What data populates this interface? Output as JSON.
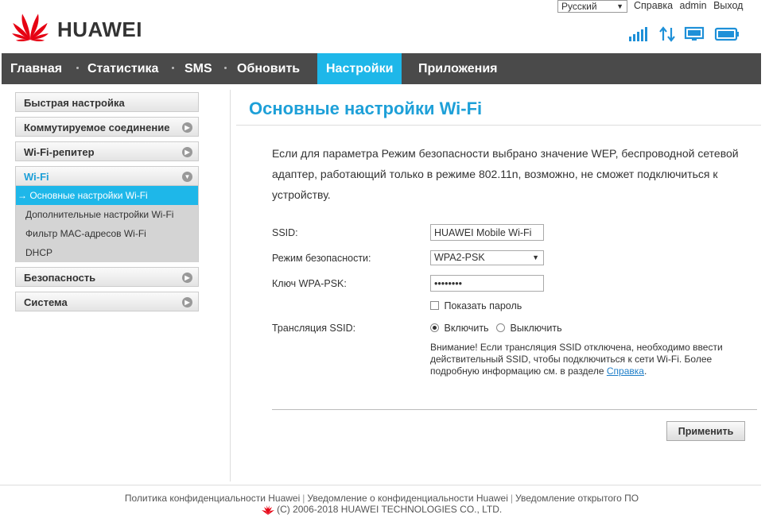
{
  "brand": {
    "name": "HUAWEI"
  },
  "top": {
    "language": "Русский",
    "links": [
      "Справка",
      "admin",
      "Выход"
    ]
  },
  "nav": {
    "items": [
      "Главная",
      "Статистика",
      "SMS",
      "Обновить",
      "Настройки",
      "Приложения"
    ],
    "active": "Настройки"
  },
  "sidebar": {
    "quick_setup": "Быстрая настройка",
    "dialup": "Коммутируемое соединение",
    "repeater": "Wi-Fi-репитер",
    "wifi": "Wi-Fi",
    "wifi_sub": [
      "→ Основные настройки Wi-Fi",
      "Дополнительные настройки Wi-Fi",
      "Фильтр MAC-адресов Wi-Fi",
      "DHCP"
    ],
    "security": "Безопасность",
    "system": "Система"
  },
  "main": {
    "title": "Основные настройки Wi-Fi",
    "description": "Если для параметра Режим безопасности выбрано значение WEP, беспроводной сетевой адаптер, работающий только в режиме 802.11n, возможно, не сможет подключиться к устройству.",
    "ssid_label": "SSID:",
    "ssid_value": "HUAWEI Mobile Wi-Fi",
    "security_label": "Режим безопасности:",
    "security_value": "WPA2-PSK",
    "key_label": "Ключ WPA-PSK:",
    "key_value": "••••••••",
    "show_password": "Показать пароль",
    "broadcast_label": "Трансляция SSID:",
    "enable": "Включить",
    "disable": "Выключить",
    "note_text": "Внимание! Если трансляция SSID отключена, необходимо ввести действительный SSID, чтобы подключиться к сети Wi-Fi. Более подробную информацию см. в разделе",
    "note_link": "Справка",
    "note_end": ".",
    "apply": "Применить"
  },
  "footer": {
    "privacy": "Политика конфиденциальности Huawei",
    "notice": "Уведомление о конфиденциальности Huawei",
    "opensource": "Уведомление открытого ПО",
    "copyright": "(C) 2006-2018 HUAWEI TECHNOLOGIES CO., LTD."
  },
  "icons": [
    "signal-icon",
    "data-transfer-icon",
    "monitor-icon",
    "battery-icon"
  ],
  "colors": {
    "accent": "#1eb7e9",
    "nav_bg": "#4a4a4a",
    "brand_red": "#e60012"
  }
}
